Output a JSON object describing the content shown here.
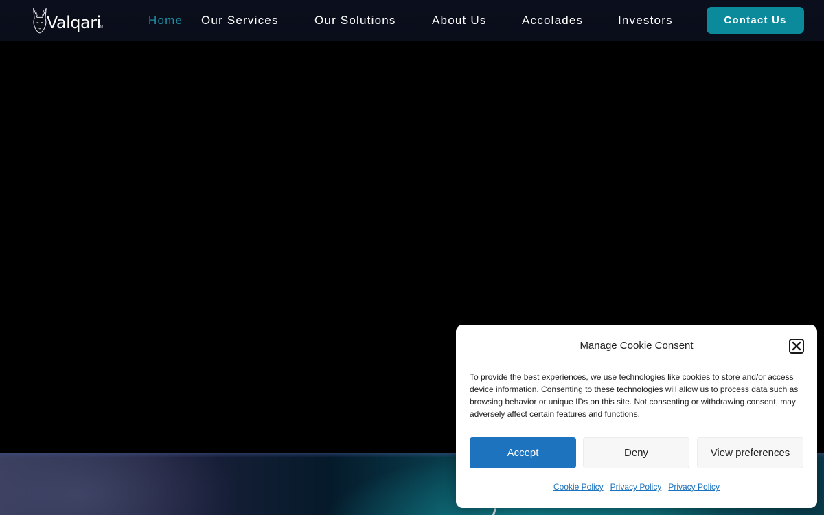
{
  "brand": {
    "name": "Valqari",
    "trademark": "TM"
  },
  "nav": {
    "items": [
      {
        "label": "Home",
        "active": true
      },
      {
        "label": "Our Services",
        "active": false
      },
      {
        "label": "Our Solutions",
        "active": false
      },
      {
        "label": "About Us",
        "active": false
      },
      {
        "label": "Accolades",
        "active": false
      },
      {
        "label": "Investors",
        "active": false
      }
    ],
    "contact_label": "Contact Us"
  },
  "cookie": {
    "title": "Manage Cookie Consent",
    "body": "To provide the best experiences, we use technologies like cookies to store and/or access device information. Consenting to these technologies will allow us to process data such as browsing behavior or unique IDs on this site. Not consenting or withdrawing consent, may adversely affect certain features and functions.",
    "accept_label": "Accept",
    "deny_label": "Deny",
    "preferences_label": "View preferences",
    "links": [
      "Cookie Policy",
      "Privacy Policy",
      "Privacy Policy"
    ],
    "close_icon": "close-icon"
  },
  "colors": {
    "nav_active": "#1f8fa6",
    "contact_button": "#0b8a9c",
    "accept_button": "#1e73be",
    "link": "#1e73be"
  }
}
